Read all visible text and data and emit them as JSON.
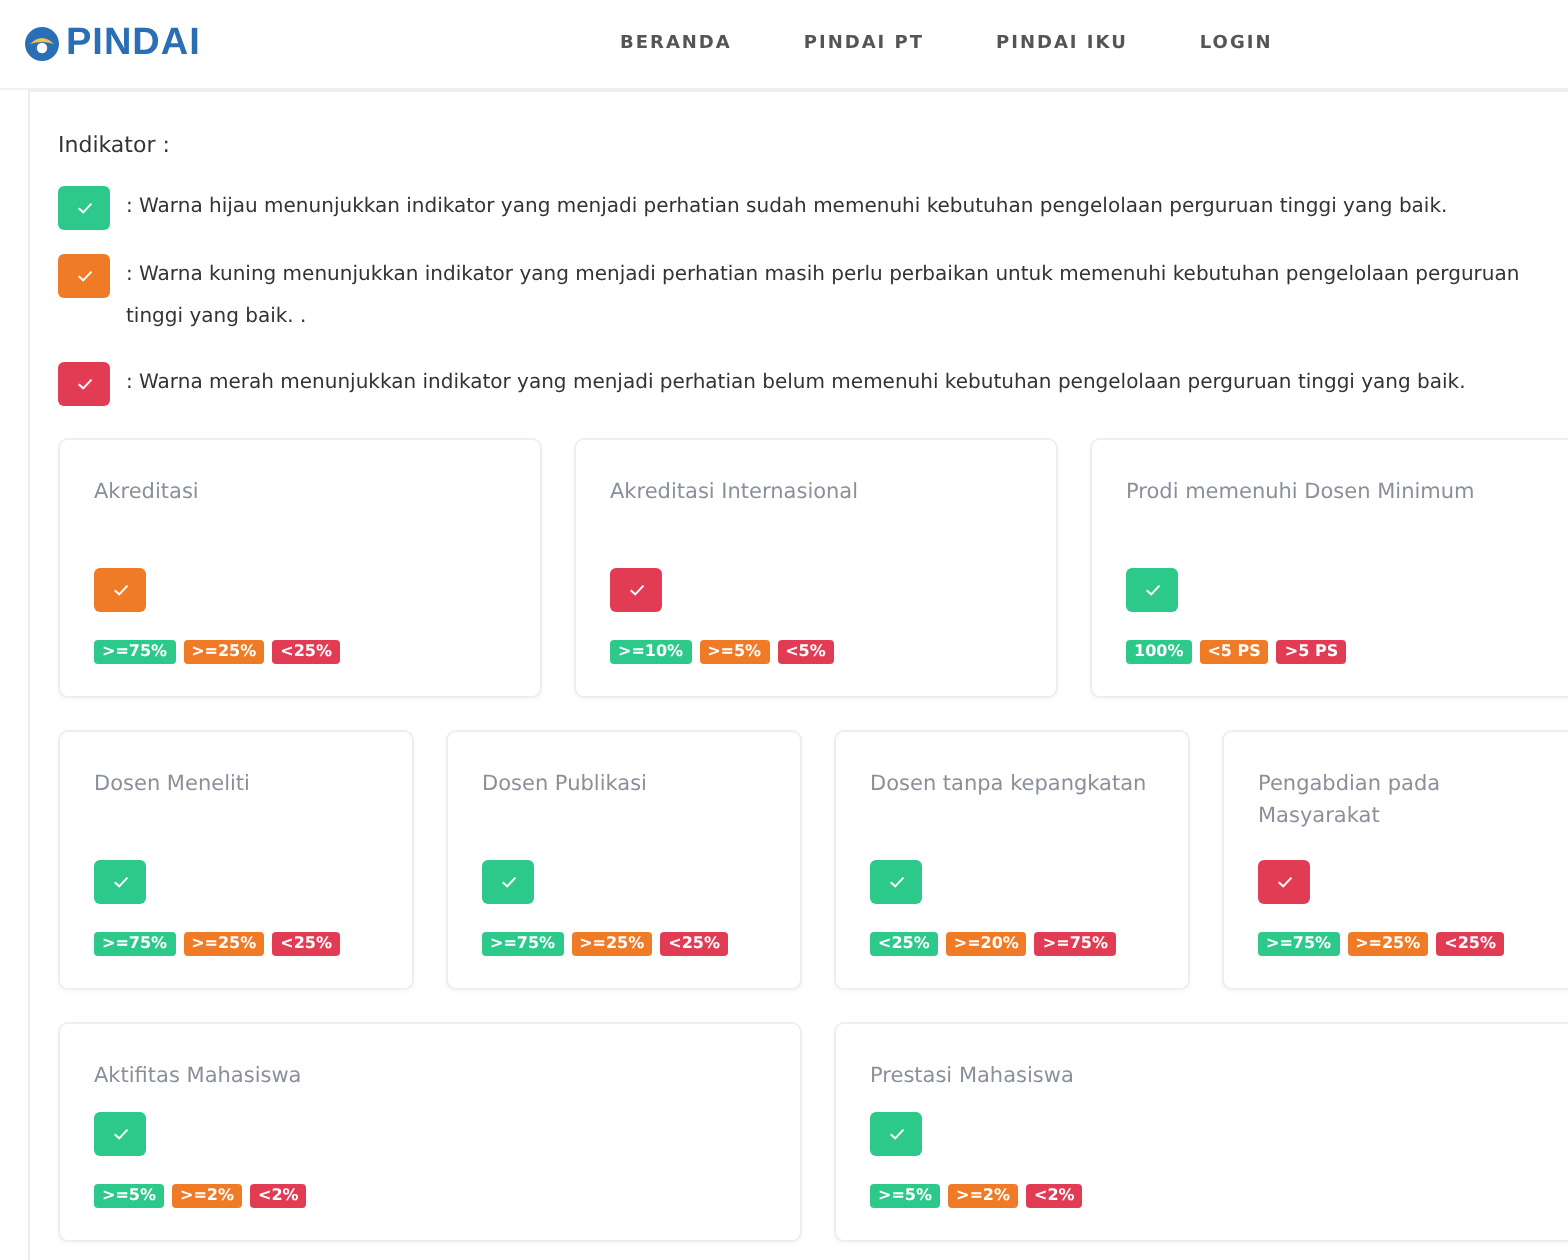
{
  "header": {
    "logo": "PINDAI",
    "nav": [
      {
        "label": "BERANDA"
      },
      {
        "label": "PINDAI PT"
      },
      {
        "label": "PINDAI IKU"
      },
      {
        "label": "LOGIN"
      }
    ]
  },
  "legend": {
    "title": "Indikator :",
    "items": [
      {
        "color": "#2dc98a",
        "text": ": Warna hijau menunjukkan indikator yang menjadi perhatian sudah memenuhi kebutuhan pengelolaan perguruan tinggi yang baik."
      },
      {
        "color": "#f07b27",
        "text": ": Warna kuning menunjukkan indikator yang menjadi perhatian masih perlu perbaikan untuk memenuhi kebutuhan pengelolaan perguruan tinggi yang baik. ."
      },
      {
        "color": "#e23c55",
        "text": ": Warna merah menunjukkan indikator yang menjadi perhatian belum memenuhi kebutuhan pengelolaan perguruan tinggi yang baik."
      }
    ]
  },
  "rows": [
    {
      "cards": [
        {
          "title": "Akreditasi",
          "color": "#f07b27",
          "badges": [
            {
              "text": ">=75%",
              "color": "#2dc98a"
            },
            {
              "text": ">=25%",
              "color": "#f07b27"
            },
            {
              "text": "<25%",
              "color": "#e23c55"
            }
          ]
        },
        {
          "title": "Akreditasi Internasional",
          "color": "#e23c55",
          "badges": [
            {
              "text": ">=10%",
              "color": "#2dc98a"
            },
            {
              "text": ">=5%",
              "color": "#f07b27"
            },
            {
              "text": "<5%",
              "color": "#e23c55"
            }
          ]
        },
        {
          "title": "Prodi memenuhi Dosen Minimum",
          "color": "#2dc98a",
          "badges": [
            {
              "text": "100%",
              "color": "#2dc98a"
            },
            {
              "text": "<5 PS",
              "color": "#f07b27"
            },
            {
              "text": ">5 PS",
              "color": "#e23c55"
            }
          ]
        }
      ]
    },
    {
      "cards": [
        {
          "title": "Dosen Meneliti",
          "color": "#2dc98a",
          "badges": [
            {
              "text": ">=75%",
              "color": "#2dc98a"
            },
            {
              "text": ">=25%",
              "color": "#f07b27"
            },
            {
              "text": "<25%",
              "color": "#e23c55"
            }
          ]
        },
        {
          "title": "Dosen Publikasi",
          "color": "#2dc98a",
          "badges": [
            {
              "text": ">=75%",
              "color": "#2dc98a"
            },
            {
              "text": ">=25%",
              "color": "#f07b27"
            },
            {
              "text": "<25%",
              "color": "#e23c55"
            }
          ]
        },
        {
          "title": "Dosen tanpa kepangkatan",
          "color": "#2dc98a",
          "badges": [
            {
              "text": "<25%",
              "color": "#2dc98a"
            },
            {
              "text": ">=20%",
              "color": "#f07b27"
            },
            {
              "text": ">=75%",
              "color": "#e23c55"
            }
          ]
        },
        {
          "title": "Pengabdian pada Masyarakat",
          "color": "#e23c55",
          "badges": [
            {
              "text": ">=75%",
              "color": "#2dc98a"
            },
            {
              "text": ">=25%",
              "color": "#f07b27"
            },
            {
              "text": "<25%",
              "color": "#e23c55"
            }
          ]
        }
      ]
    },
    {
      "cards": [
        {
          "title": "Aktifitas Mahasiswa",
          "color": "#2dc98a",
          "badges": [
            {
              "text": ">=5%",
              "color": "#2dc98a"
            },
            {
              "text": ">=2%",
              "color": "#f07b27"
            },
            {
              "text": "<2%",
              "color": "#e23c55"
            }
          ]
        },
        {
          "title": "Prestasi Mahasiswa",
          "color": "#2dc98a",
          "badges": [
            {
              "text": ">=5%",
              "color": "#2dc98a"
            },
            {
              "text": ">=2%",
              "color": "#f07b27"
            },
            {
              "text": "<2%",
              "color": "#e23c55"
            }
          ]
        }
      ]
    }
  ]
}
